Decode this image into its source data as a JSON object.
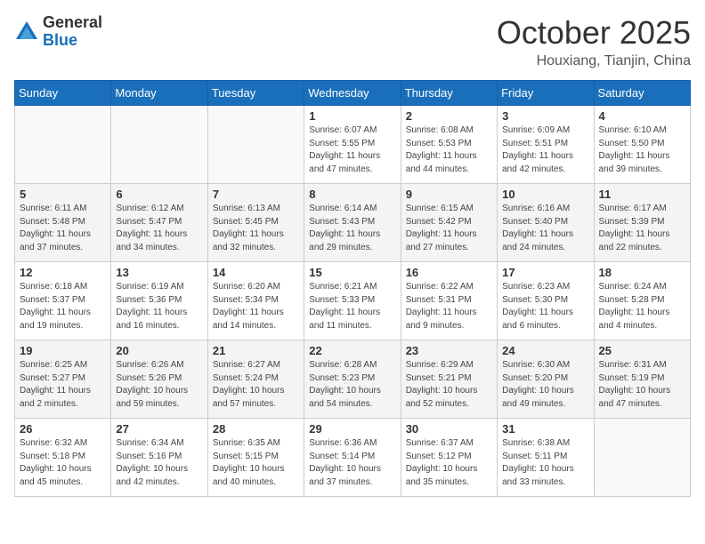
{
  "header": {
    "logo_general": "General",
    "logo_blue": "Blue",
    "month": "October 2025",
    "location": "Houxiang, Tianjin, China"
  },
  "weekdays": [
    "Sunday",
    "Monday",
    "Tuesday",
    "Wednesday",
    "Thursday",
    "Friday",
    "Saturday"
  ],
  "weeks": [
    [
      {
        "day": "",
        "info": ""
      },
      {
        "day": "",
        "info": ""
      },
      {
        "day": "",
        "info": ""
      },
      {
        "day": "1",
        "info": "Sunrise: 6:07 AM\nSunset: 5:55 PM\nDaylight: 11 hours\nand 47 minutes."
      },
      {
        "day": "2",
        "info": "Sunrise: 6:08 AM\nSunset: 5:53 PM\nDaylight: 11 hours\nand 44 minutes."
      },
      {
        "day": "3",
        "info": "Sunrise: 6:09 AM\nSunset: 5:51 PM\nDaylight: 11 hours\nand 42 minutes."
      },
      {
        "day": "4",
        "info": "Sunrise: 6:10 AM\nSunset: 5:50 PM\nDaylight: 11 hours\nand 39 minutes."
      }
    ],
    [
      {
        "day": "5",
        "info": "Sunrise: 6:11 AM\nSunset: 5:48 PM\nDaylight: 11 hours\nand 37 minutes."
      },
      {
        "day": "6",
        "info": "Sunrise: 6:12 AM\nSunset: 5:47 PM\nDaylight: 11 hours\nand 34 minutes."
      },
      {
        "day": "7",
        "info": "Sunrise: 6:13 AM\nSunset: 5:45 PM\nDaylight: 11 hours\nand 32 minutes."
      },
      {
        "day": "8",
        "info": "Sunrise: 6:14 AM\nSunset: 5:43 PM\nDaylight: 11 hours\nand 29 minutes."
      },
      {
        "day": "9",
        "info": "Sunrise: 6:15 AM\nSunset: 5:42 PM\nDaylight: 11 hours\nand 27 minutes."
      },
      {
        "day": "10",
        "info": "Sunrise: 6:16 AM\nSunset: 5:40 PM\nDaylight: 11 hours\nand 24 minutes."
      },
      {
        "day": "11",
        "info": "Sunrise: 6:17 AM\nSunset: 5:39 PM\nDaylight: 11 hours\nand 22 minutes."
      }
    ],
    [
      {
        "day": "12",
        "info": "Sunrise: 6:18 AM\nSunset: 5:37 PM\nDaylight: 11 hours\nand 19 minutes."
      },
      {
        "day": "13",
        "info": "Sunrise: 6:19 AM\nSunset: 5:36 PM\nDaylight: 11 hours\nand 16 minutes."
      },
      {
        "day": "14",
        "info": "Sunrise: 6:20 AM\nSunset: 5:34 PM\nDaylight: 11 hours\nand 14 minutes."
      },
      {
        "day": "15",
        "info": "Sunrise: 6:21 AM\nSunset: 5:33 PM\nDaylight: 11 hours\nand 11 minutes."
      },
      {
        "day": "16",
        "info": "Sunrise: 6:22 AM\nSunset: 5:31 PM\nDaylight: 11 hours\nand 9 minutes."
      },
      {
        "day": "17",
        "info": "Sunrise: 6:23 AM\nSunset: 5:30 PM\nDaylight: 11 hours\nand 6 minutes."
      },
      {
        "day": "18",
        "info": "Sunrise: 6:24 AM\nSunset: 5:28 PM\nDaylight: 11 hours\nand 4 minutes."
      }
    ],
    [
      {
        "day": "19",
        "info": "Sunrise: 6:25 AM\nSunset: 5:27 PM\nDaylight: 11 hours\nand 2 minutes."
      },
      {
        "day": "20",
        "info": "Sunrise: 6:26 AM\nSunset: 5:26 PM\nDaylight: 10 hours\nand 59 minutes."
      },
      {
        "day": "21",
        "info": "Sunrise: 6:27 AM\nSunset: 5:24 PM\nDaylight: 10 hours\nand 57 minutes."
      },
      {
        "day": "22",
        "info": "Sunrise: 6:28 AM\nSunset: 5:23 PM\nDaylight: 10 hours\nand 54 minutes."
      },
      {
        "day": "23",
        "info": "Sunrise: 6:29 AM\nSunset: 5:21 PM\nDaylight: 10 hours\nand 52 minutes."
      },
      {
        "day": "24",
        "info": "Sunrise: 6:30 AM\nSunset: 5:20 PM\nDaylight: 10 hours\nand 49 minutes."
      },
      {
        "day": "25",
        "info": "Sunrise: 6:31 AM\nSunset: 5:19 PM\nDaylight: 10 hours\nand 47 minutes."
      }
    ],
    [
      {
        "day": "26",
        "info": "Sunrise: 6:32 AM\nSunset: 5:18 PM\nDaylight: 10 hours\nand 45 minutes."
      },
      {
        "day": "27",
        "info": "Sunrise: 6:34 AM\nSunset: 5:16 PM\nDaylight: 10 hours\nand 42 minutes."
      },
      {
        "day": "28",
        "info": "Sunrise: 6:35 AM\nSunset: 5:15 PM\nDaylight: 10 hours\nand 40 minutes."
      },
      {
        "day": "29",
        "info": "Sunrise: 6:36 AM\nSunset: 5:14 PM\nDaylight: 10 hours\nand 37 minutes."
      },
      {
        "day": "30",
        "info": "Sunrise: 6:37 AM\nSunset: 5:12 PM\nDaylight: 10 hours\nand 35 minutes."
      },
      {
        "day": "31",
        "info": "Sunrise: 6:38 AM\nSunset: 5:11 PM\nDaylight: 10 hours\nand 33 minutes."
      },
      {
        "day": "",
        "info": ""
      }
    ]
  ]
}
